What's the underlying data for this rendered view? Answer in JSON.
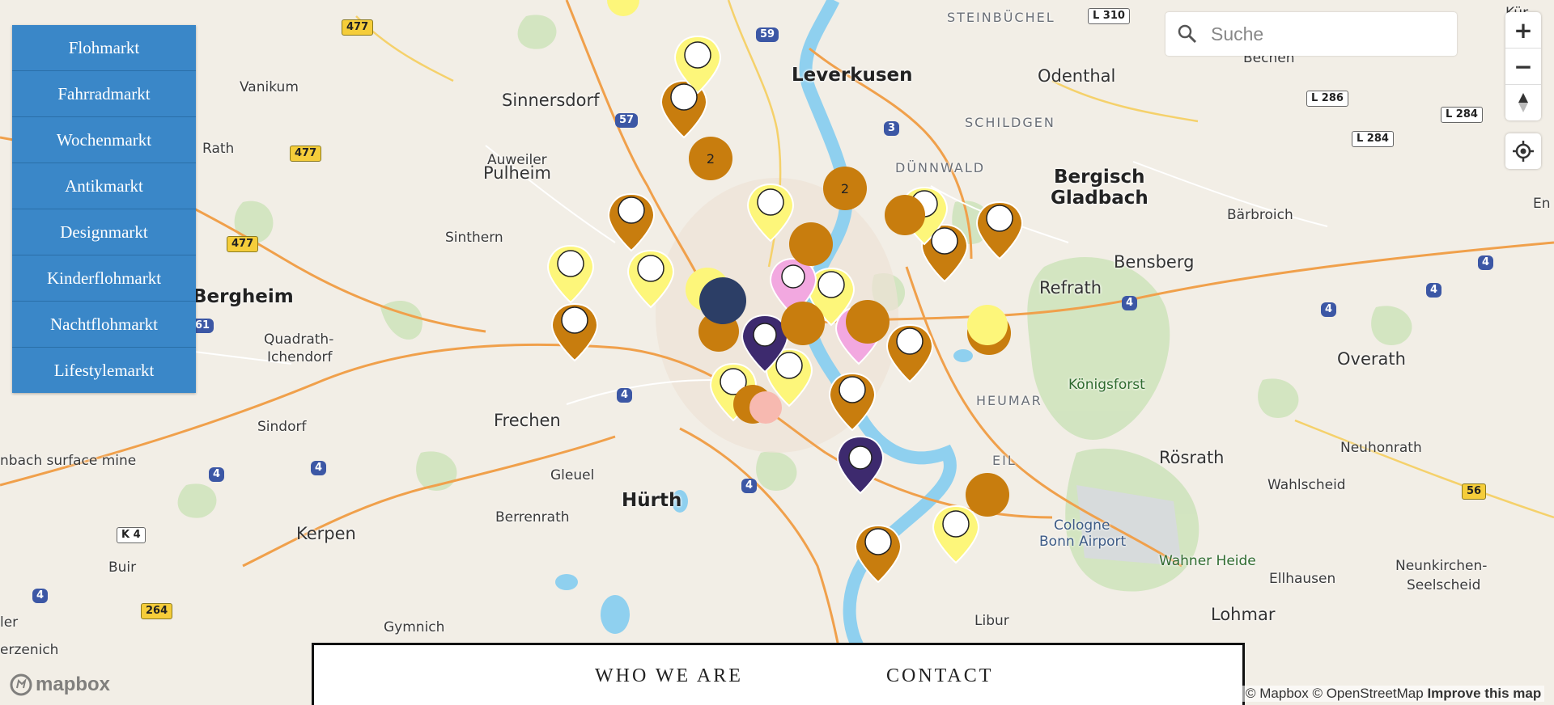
{
  "menu": {
    "items": [
      {
        "label": "Flohmarkt"
      },
      {
        "label": "Fahrradmarkt"
      },
      {
        "label": "Wochenmarkt"
      },
      {
        "label": "Antikmarkt"
      },
      {
        "label": "Designmarkt"
      },
      {
        "label": "Kinderflohmarkt"
      },
      {
        "label": "Nachtflohmarkt"
      },
      {
        "label": "Lifestylemarkt"
      }
    ]
  },
  "search": {
    "placeholder": "Suche",
    "value": ""
  },
  "controls": {
    "zoom_in": "+",
    "zoom_out": "−"
  },
  "footer": {
    "who_we_are": "WHO WE ARE",
    "contact": "CONTACT"
  },
  "attribution": {
    "text": "© Mapbox © OpenStreetMap",
    "improve": "Improve this map"
  },
  "logo": {
    "text": "mapbox"
  },
  "colors": {
    "menu_bg": "#3a87c8",
    "marker_orange": "#c87d0e",
    "marker_yellow": "#fdf67a",
    "marker_purple": "#3d2a6e",
    "marker_pink": "#f2a8e0",
    "marker_navy": "#2c3e66"
  },
  "map": {
    "places": [
      {
        "name": "Leverkusen",
        "kind": "city"
      },
      {
        "name": "Bergisch",
        "kind": "city"
      },
      {
        "name": "Gladbach",
        "kind": "city"
      },
      {
        "name": "Hürth",
        "kind": "city"
      },
      {
        "name": "Bergheim",
        "kind": "city"
      },
      {
        "name": "Pulheim",
        "kind": "town"
      },
      {
        "name": "Frechen",
        "kind": "town"
      },
      {
        "name": "Kerpen",
        "kind": "town"
      },
      {
        "name": "Sinnersdorf",
        "kind": "town"
      },
      {
        "name": "Odenthal",
        "kind": "town"
      },
      {
        "name": "Bensberg",
        "kind": "town"
      },
      {
        "name": "Refrath",
        "kind": "town"
      },
      {
        "name": "Overath",
        "kind": "town"
      },
      {
        "name": "Rösrath",
        "kind": "town"
      },
      {
        "name": "Lohmar",
        "kind": "town"
      },
      {
        "name": "Auweiler",
        "kind": "small"
      },
      {
        "name": "Sinthern",
        "kind": "small"
      },
      {
        "name": "Vanikum",
        "kind": "small"
      },
      {
        "name": "Rath",
        "kind": "small"
      },
      {
        "name": "Quadrath-",
        "kind": "small"
      },
      {
        "name": "Ichendorf",
        "kind": "small"
      },
      {
        "name": "Sindorf",
        "kind": "small"
      },
      {
        "name": "Gleuel",
        "kind": "small"
      },
      {
        "name": "Berrenrath",
        "kind": "small"
      },
      {
        "name": "Buir",
        "kind": "small"
      },
      {
        "name": "Gymnich",
        "kind": "small"
      },
      {
        "name": "Libur",
        "kind": "small"
      },
      {
        "name": "Ellhausen",
        "kind": "small"
      },
      {
        "name": "Neunkirchen-",
        "kind": "small"
      },
      {
        "name": "Seelscheid",
        "kind": "small"
      },
      {
        "name": "Wahlscheid",
        "kind": "small"
      },
      {
        "name": "Neuhonrath",
        "kind": "small"
      },
      {
        "name": "Bärbroich",
        "kind": "small"
      },
      {
        "name": "Bechen",
        "kind": "small"
      },
      {
        "name": "erzenich",
        "kind": "small"
      },
      {
        "name": "ler",
        "kind": "small"
      },
      {
        "name": "En",
        "kind": "small"
      },
      {
        "name": "Kür",
        "kind": "small"
      },
      {
        "name": "nbach surface mine",
        "kind": "small"
      },
      {
        "name": "STEINBÜCHEL",
        "kind": "district"
      },
      {
        "name": "SCHILDGEN",
        "kind": "district"
      },
      {
        "name": "DÜNNWALD",
        "kind": "district"
      },
      {
        "name": "HEUMAR",
        "kind": "district"
      },
      {
        "name": "EIL",
        "kind": "district"
      },
      {
        "name": "Königsforst",
        "kind": "park"
      },
      {
        "name": "Wahner Heide",
        "kind": "park"
      },
      {
        "name": "Cologne",
        "kind": "airport"
      },
      {
        "name": "Bonn Airport",
        "kind": "airport"
      }
    ],
    "shields": [
      {
        "label": "477",
        "style": "yellow"
      },
      {
        "label": "477",
        "style": "yellow"
      },
      {
        "label": "477",
        "style": "yellow"
      },
      {
        "label": "59",
        "style": "blue"
      },
      {
        "label": "57",
        "style": "blue"
      },
      {
        "label": "3",
        "style": "blue"
      },
      {
        "label": "4",
        "style": "blue"
      },
      {
        "label": "4",
        "style": "blue"
      },
      {
        "label": "4",
        "style": "blue"
      },
      {
        "label": "4",
        "style": "blue"
      },
      {
        "label": "4",
        "style": "blue"
      },
      {
        "label": "4",
        "style": "blue"
      },
      {
        "label": "4",
        "style": "blue"
      },
      {
        "label": "4",
        "style": "blue"
      },
      {
        "label": "4",
        "style": "blue"
      },
      {
        "label": "61",
        "style": "blue"
      },
      {
        "label": "L 310",
        "style": "white"
      },
      {
        "label": "L 286",
        "style": "white"
      },
      {
        "label": "L 284",
        "style": "white"
      },
      {
        "label": "L 284",
        "style": "white"
      },
      {
        "label": "K 4",
        "style": "white"
      },
      {
        "label": "264",
        "style": "yellow"
      },
      {
        "label": "56",
        "style": "yellow"
      }
    ],
    "cluster_counts": [
      "2",
      "2"
    ]
  }
}
